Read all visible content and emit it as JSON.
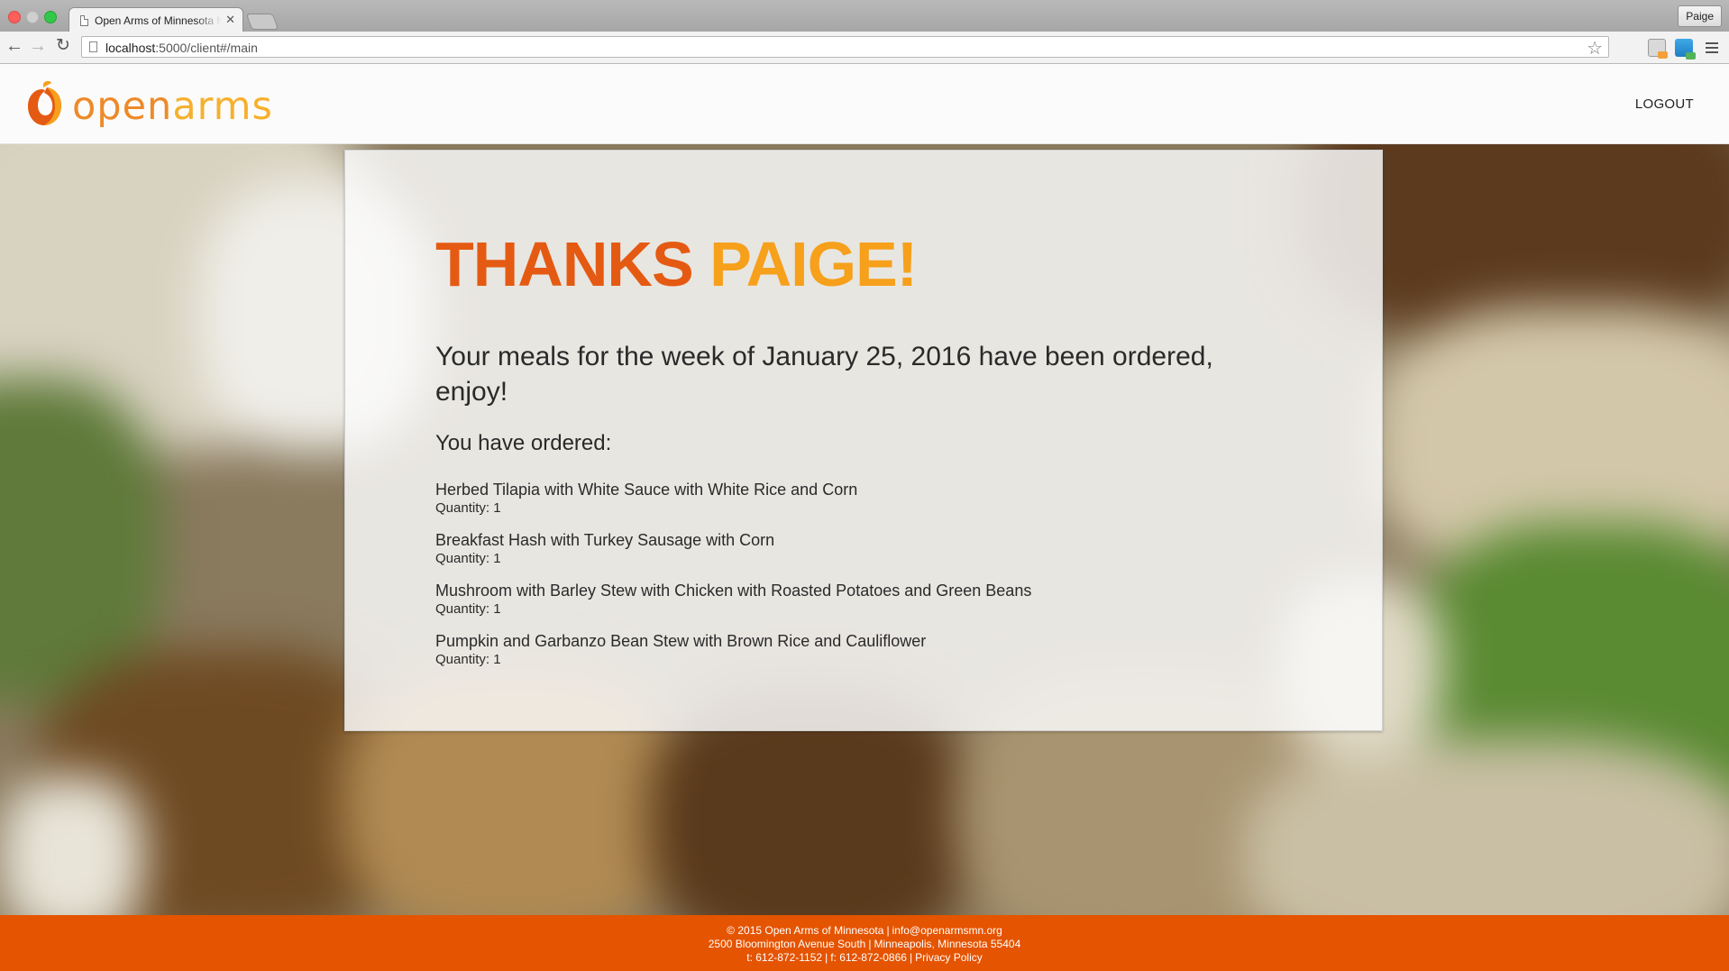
{
  "browser": {
    "tab_title": "Open Arms of Minnesota M",
    "tab_close": "✕",
    "profile_name": "Paige",
    "url_host": "localhost",
    "url_rest": ":5000/client#/main"
  },
  "header": {
    "logo_open": "open",
    "logo_arms": "arms",
    "logout_label": "LOGOUT"
  },
  "card": {
    "thanks_word": "THANKS",
    "thanks_name": "PAIGE!",
    "confirmation": "Your meals for the week of January 25, 2016 have been ordered, enjoy!",
    "ordered_heading": "You have ordered:",
    "orders": [
      {
        "name": "Herbed Tilapia with White Sauce with White Rice and Corn",
        "quantity": "Quantity: 1"
      },
      {
        "name": "Breakfast Hash with Turkey Sausage with Corn",
        "quantity": "Quantity: 1"
      },
      {
        "name": "Mushroom with Barley Stew with Chicken with Roasted Potatoes and Green Beans",
        "quantity": "Quantity: 1"
      },
      {
        "name": "Pumpkin and Garbanzo Bean Stew with Brown Rice and Cauliflower",
        "quantity": "Quantity: 1"
      }
    ]
  },
  "footer": {
    "copyright": "© 2015 Open Arms of Minnesota",
    "email": "info@openarmsmn.org",
    "address_street": "2500 Bloomington Avenue South",
    "address_city": "Minneapolis, Minnesota 55404",
    "phone": "t: 612-872-1152",
    "fax": "f: 612-872-0866",
    "privacy": "Privacy Policy"
  },
  "colors": {
    "brand_orange": "#e55a12",
    "brand_yellow": "#f6a01b",
    "footer_bg": "#e55400"
  }
}
